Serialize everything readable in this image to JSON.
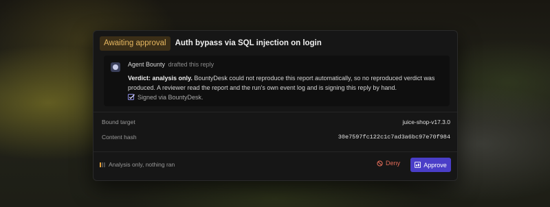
{
  "request": {
    "status_badge": "Awaiting approval",
    "title": "Auth bypass via SQL injection on login"
  },
  "reply": {
    "author": "Agent Bounty",
    "action": "drafted this reply",
    "verdict_label": "Verdict: analysis only.",
    "message": " BountyDesk could not reproduce this report automatically, so no reproduced verdict was produced. A reviewer read the report and the run's own event log and is signing this reply by hand.",
    "signed_text": "Signed via BountyDesk."
  },
  "details": {
    "bound_target_label": "Bound target",
    "bound_target_value": "juice-shop-v17.3.0",
    "content_hash_label": "Content hash",
    "content_hash_value": "30e7597fc122c1c7ad3a6bc97e70f984"
  },
  "footer": {
    "status_text": "Analysis only, nothing ran",
    "deny_label": "Deny",
    "approve_label": "Approve"
  },
  "colors": {
    "accent": "#4a3ec8",
    "badge_text": "#e8b860",
    "deny": "#e06b58"
  },
  "icons": {
    "avatar": "robot-avatar-icon",
    "signed": "checkbox-check-icon",
    "status": "progress-bars-icon",
    "deny": "ban-icon",
    "approve": "approve-icon"
  }
}
